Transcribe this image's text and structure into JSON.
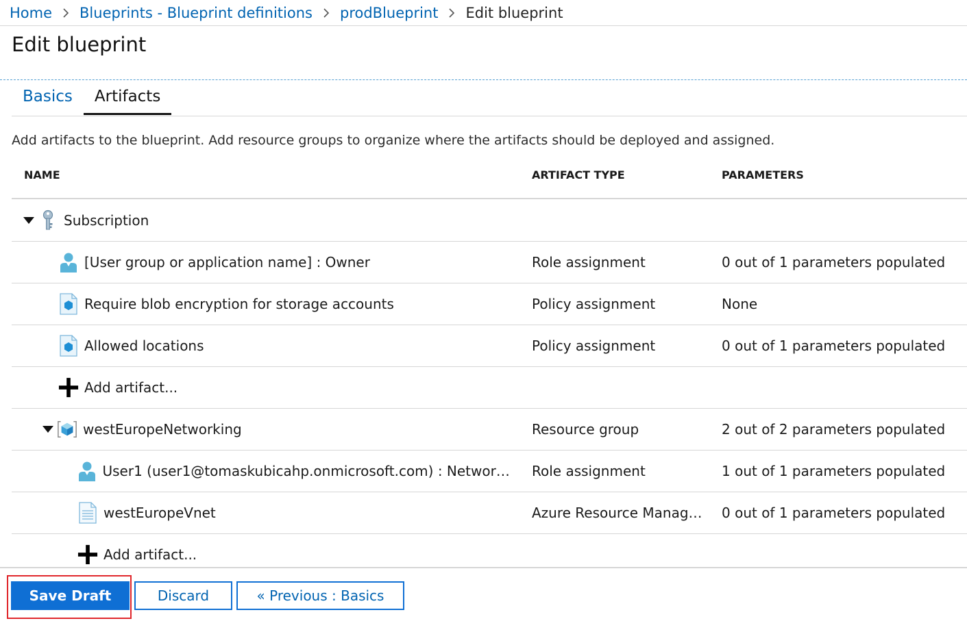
{
  "breadcrumb": {
    "items": [
      {
        "label": "Home"
      },
      {
        "label": "Blueprints - Blueprint definitions"
      },
      {
        "label": "prodBlueprint"
      }
    ],
    "current": "Edit blueprint"
  },
  "page": {
    "title": "Edit blueprint",
    "description": "Add artifacts to the blueprint. Add resource groups to organize where the artifacts should be deployed and assigned."
  },
  "tabs": [
    {
      "label": "Basics",
      "active": false
    },
    {
      "label": "Artifacts",
      "active": true
    }
  ],
  "table": {
    "columns": {
      "name": "NAME",
      "type": "ARTIFACT TYPE",
      "parameters": "PARAMETERS"
    },
    "rows": [
      {
        "kind": "group",
        "icon": "key-icon",
        "name": "Subscription",
        "type": "",
        "parameters": ""
      },
      {
        "kind": "item",
        "icon": "user-icon",
        "name": "[User group or application name] : Owner",
        "type": "Role assignment",
        "parameters": "0 out of 1 parameters populated"
      },
      {
        "kind": "item",
        "icon": "policy-icon",
        "name": "Require blob encryption for storage accounts",
        "type": "Policy assignment",
        "parameters": "None"
      },
      {
        "kind": "item",
        "icon": "policy-icon",
        "name": "Allowed locations",
        "type": "Policy assignment",
        "parameters": "0 out of 1 parameters populated"
      },
      {
        "kind": "add",
        "icon": "plus-icon",
        "name": "Add artifact...",
        "type": "",
        "parameters": ""
      },
      {
        "kind": "group",
        "icon": "resource-group-icon",
        "name": "westEuropeNetworking",
        "type": "Resource group",
        "parameters": "2 out of 2 parameters populated"
      },
      {
        "kind": "item",
        "icon": "user-icon",
        "name": "User1 (user1@tomaskubicahp.onmicrosoft.com) : Network Co...",
        "type": "Role assignment",
        "parameters": "1 out of 1 parameters populated"
      },
      {
        "kind": "item",
        "icon": "template-icon",
        "name": "westEuropeVnet",
        "type": "Azure Resource Manager...",
        "parameters": "0 out of 1 parameters populated"
      },
      {
        "kind": "add",
        "icon": "plus-icon",
        "name": "Add artifact...",
        "type": "",
        "parameters": ""
      }
    ]
  },
  "footer": {
    "save_label": "Save Draft",
    "discard_label": "Discard",
    "previous_label": "« Previous : Basics"
  },
  "colors": {
    "link": "#0063b1",
    "primary": "#0f6fd4",
    "highlight": "#e0262b",
    "divider": "#d6d6d6"
  }
}
